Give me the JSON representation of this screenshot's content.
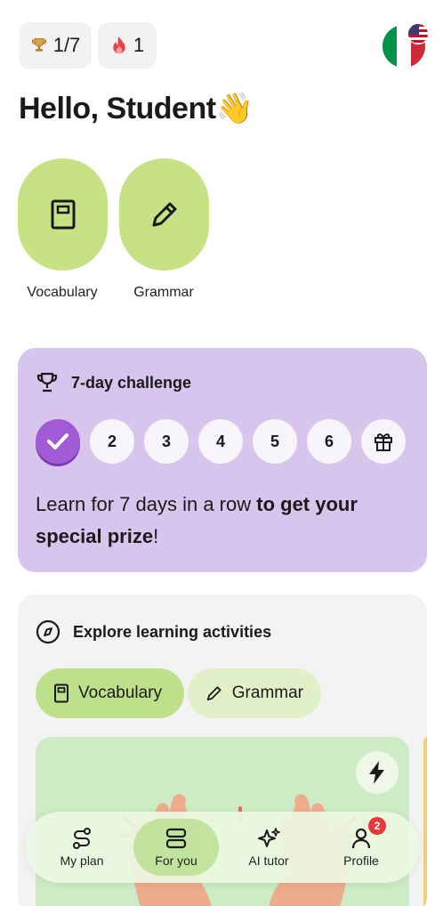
{
  "status": {
    "level": "1/7",
    "streak": "1",
    "trophy_icon": "trophy-icon",
    "flame_icon": "flame-icon",
    "language_flags": [
      "italy-flag",
      "us-flag"
    ]
  },
  "greeting": "Hello, Student👋",
  "categories": [
    {
      "label": "Vocabulary",
      "icon": "notebook-icon"
    },
    {
      "label": "Grammar",
      "icon": "pencil-icon"
    }
  ],
  "challenge": {
    "title": "7-day challenge",
    "days": [
      "2",
      "3",
      "4",
      "5",
      "6"
    ],
    "completed_days": 1,
    "text_plain": "Learn for 7 days in a row ",
    "text_bold_1": "to get your",
    "text_bold_2": "special prize",
    "text_end": "!",
    "colors": {
      "background": "#d8c5ee",
      "check": "#a25ad6"
    }
  },
  "explore": {
    "title": "Explore learning activities",
    "tabs": [
      {
        "label": "Vocabulary",
        "icon": "notebook-icon",
        "selected": true
      },
      {
        "label": "Grammar",
        "icon": "pencil-icon",
        "selected": false
      }
    ]
  },
  "nav": {
    "items": [
      {
        "label": "My plan",
        "icon": "route-icon"
      },
      {
        "label": "For you",
        "icon": "cards-icon",
        "active": true
      },
      {
        "label": "AI tutor",
        "icon": "sparkle-icon"
      },
      {
        "label": "Profile",
        "icon": "person-icon"
      }
    ],
    "profile_badge": "2"
  },
  "colors": {
    "accent_green": "#c6e285",
    "nav_bg": "#ecf8e2",
    "badge": "#e53a3a"
  }
}
